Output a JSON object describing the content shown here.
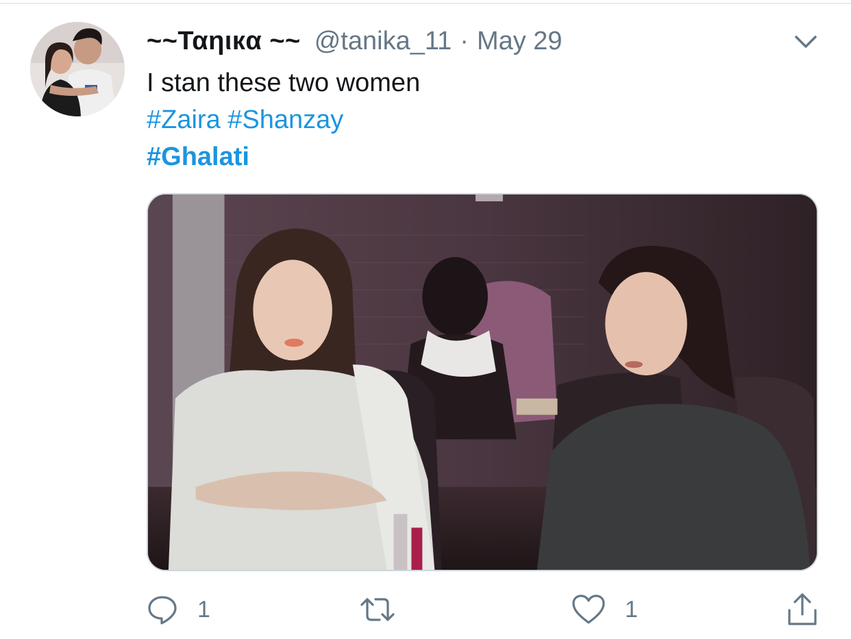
{
  "tweet": {
    "display_name": "~~Ταηιкα ~~",
    "handle": "@tanika_11",
    "separator": "·",
    "date": "May 29",
    "text_line1": "I stan these two women",
    "hashtags_line2": [
      "#Zaira",
      "#Shanzay"
    ],
    "hashtag_line3": "#Ghalati"
  },
  "actions": {
    "reply_icon": "reply-icon",
    "reply_count": "1",
    "retweet_icon": "retweet-icon",
    "like_icon": "heart-icon",
    "like_count": "1",
    "share_icon": "share-icon"
  },
  "colors": {
    "text": "#14171a",
    "secondary": "#657786",
    "link": "#1b95e0",
    "border": "#ccd6dd"
  }
}
